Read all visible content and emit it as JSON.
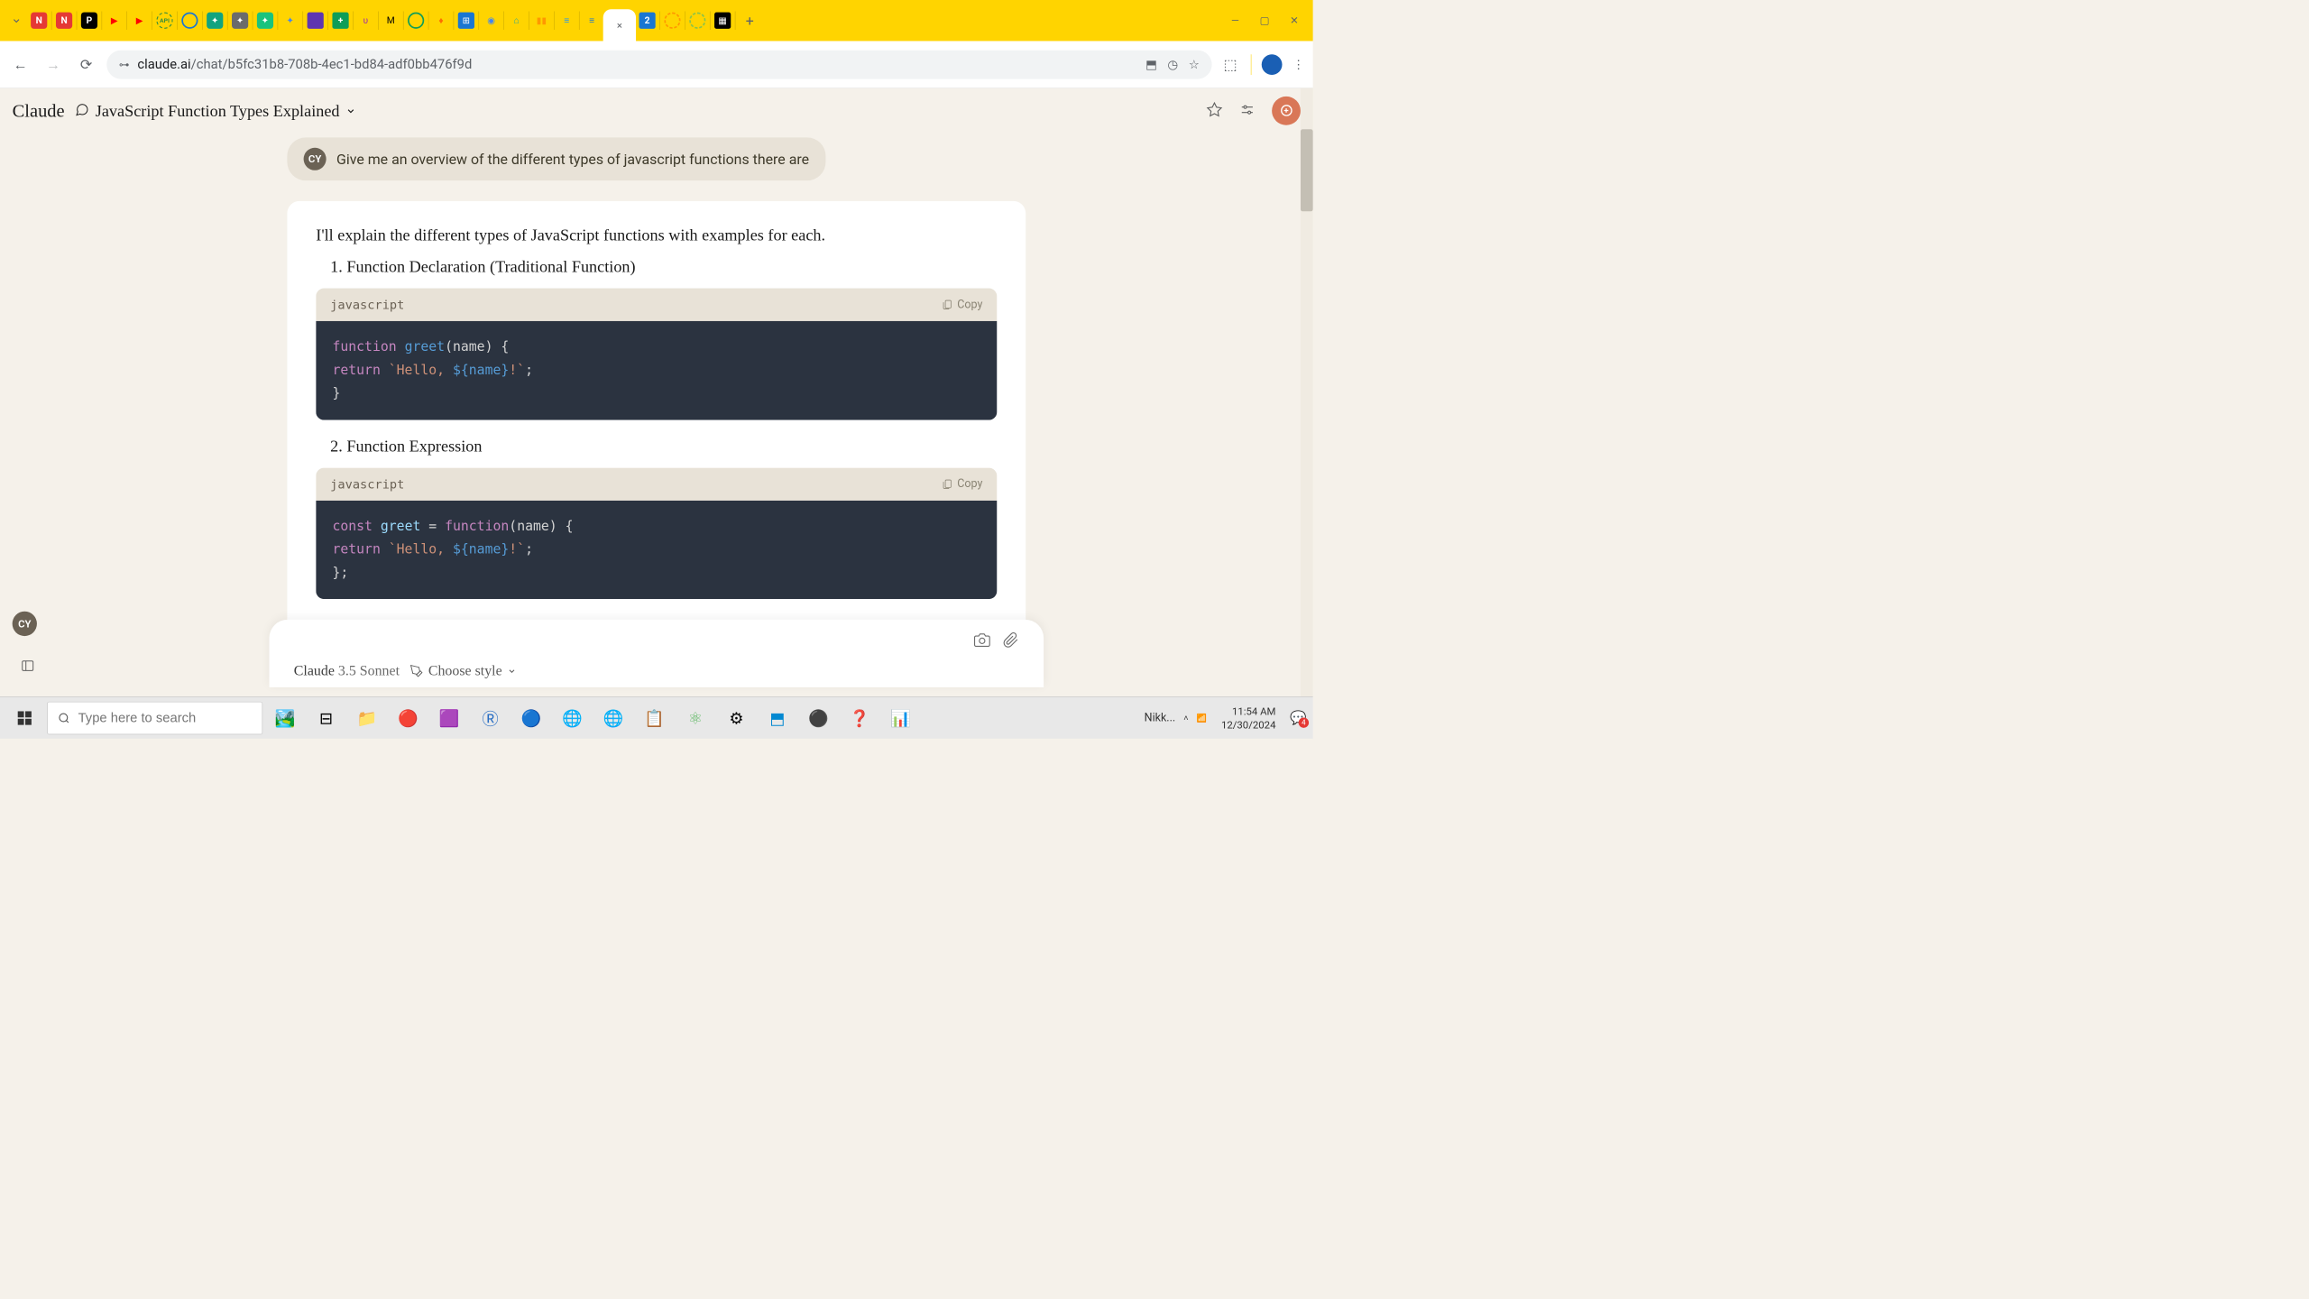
{
  "browser": {
    "url_domain": "claude.ai",
    "url_path": "/chat/b5fc31b8-708b-4ec1-bd84-adf0bb476f9d",
    "new_tab_plus": "+",
    "active_tab_close": "×",
    "win_min": "—",
    "win_max": "▢",
    "win_close": "✕"
  },
  "claude": {
    "logo": "Claude",
    "chat_title": "JavaScript Function Types Explained",
    "user_initials": "CY",
    "user_message": "Give me an overview of the different types of javascript functions there are",
    "intro": "I'll explain the different types of JavaScript functions with examples for each.",
    "sections": [
      {
        "heading": "1. Function Declaration (Traditional Function)"
      },
      {
        "heading": "2. Function Expression"
      }
    ],
    "code": {
      "lang": "javascript",
      "copy_label": "Copy",
      "block1": {
        "l1_kw": "function",
        "l1_name": "greet",
        "l1_rest": "(name) {",
        "l2_kw": "return",
        "l2_str": "`Hello, ",
        "l2_tmpl": "${name}",
        "l2_str2": "!`",
        "l2_semi": ";",
        "l3": "}"
      },
      "block2": {
        "l1_kw": "const",
        "l1_var": "greet",
        "l1_eq": " = ",
        "l1_fn": "function",
        "l1_rest": "(name) {",
        "l2_kw": "return",
        "l2_str": "`Hello, ",
        "l2_tmpl": "${name}",
        "l2_str2": "!`",
        "l2_semi": ";",
        "l3": "};"
      }
    },
    "model_label": "Claude",
    "model_version": "3.5 Sonnet",
    "style_label": "Choose style"
  },
  "taskbar": {
    "search_placeholder": "Type here to search",
    "user_label": "Nikk...",
    "time": "11:54 AM",
    "date": "12/30/2024",
    "notif_count": "4"
  }
}
